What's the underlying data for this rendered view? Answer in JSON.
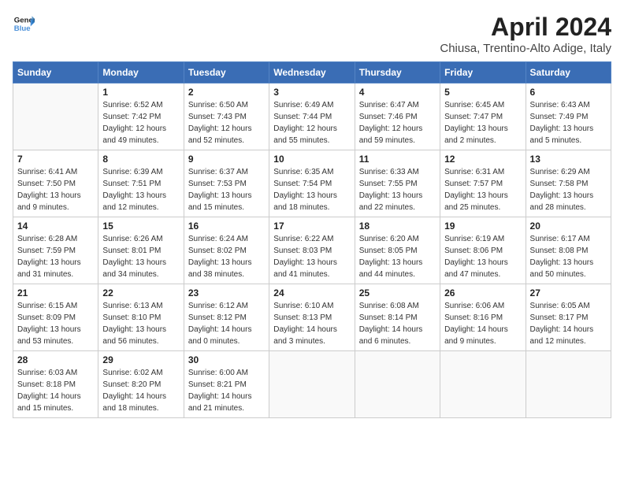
{
  "header": {
    "logo_line1": "General",
    "logo_line2": "Blue",
    "month_title": "April 2024",
    "subtitle": "Chiusa, Trentino-Alto Adige, Italy"
  },
  "weekdays": [
    "Sunday",
    "Monday",
    "Tuesday",
    "Wednesday",
    "Thursday",
    "Friday",
    "Saturday"
  ],
  "weeks": [
    [
      {
        "day": "",
        "info": ""
      },
      {
        "day": "1",
        "info": "Sunrise: 6:52 AM\nSunset: 7:42 PM\nDaylight: 12 hours\nand 49 minutes."
      },
      {
        "day": "2",
        "info": "Sunrise: 6:50 AM\nSunset: 7:43 PM\nDaylight: 12 hours\nand 52 minutes."
      },
      {
        "day": "3",
        "info": "Sunrise: 6:49 AM\nSunset: 7:44 PM\nDaylight: 12 hours\nand 55 minutes."
      },
      {
        "day": "4",
        "info": "Sunrise: 6:47 AM\nSunset: 7:46 PM\nDaylight: 12 hours\nand 59 minutes."
      },
      {
        "day": "5",
        "info": "Sunrise: 6:45 AM\nSunset: 7:47 PM\nDaylight: 13 hours\nand 2 minutes."
      },
      {
        "day": "6",
        "info": "Sunrise: 6:43 AM\nSunset: 7:49 PM\nDaylight: 13 hours\nand 5 minutes."
      }
    ],
    [
      {
        "day": "7",
        "info": "Sunrise: 6:41 AM\nSunset: 7:50 PM\nDaylight: 13 hours\nand 9 minutes."
      },
      {
        "day": "8",
        "info": "Sunrise: 6:39 AM\nSunset: 7:51 PM\nDaylight: 13 hours\nand 12 minutes."
      },
      {
        "day": "9",
        "info": "Sunrise: 6:37 AM\nSunset: 7:53 PM\nDaylight: 13 hours\nand 15 minutes."
      },
      {
        "day": "10",
        "info": "Sunrise: 6:35 AM\nSunset: 7:54 PM\nDaylight: 13 hours\nand 18 minutes."
      },
      {
        "day": "11",
        "info": "Sunrise: 6:33 AM\nSunset: 7:55 PM\nDaylight: 13 hours\nand 22 minutes."
      },
      {
        "day": "12",
        "info": "Sunrise: 6:31 AM\nSunset: 7:57 PM\nDaylight: 13 hours\nand 25 minutes."
      },
      {
        "day": "13",
        "info": "Sunrise: 6:29 AM\nSunset: 7:58 PM\nDaylight: 13 hours\nand 28 minutes."
      }
    ],
    [
      {
        "day": "14",
        "info": "Sunrise: 6:28 AM\nSunset: 7:59 PM\nDaylight: 13 hours\nand 31 minutes."
      },
      {
        "day": "15",
        "info": "Sunrise: 6:26 AM\nSunset: 8:01 PM\nDaylight: 13 hours\nand 34 minutes."
      },
      {
        "day": "16",
        "info": "Sunrise: 6:24 AM\nSunset: 8:02 PM\nDaylight: 13 hours\nand 38 minutes."
      },
      {
        "day": "17",
        "info": "Sunrise: 6:22 AM\nSunset: 8:03 PM\nDaylight: 13 hours\nand 41 minutes."
      },
      {
        "day": "18",
        "info": "Sunrise: 6:20 AM\nSunset: 8:05 PM\nDaylight: 13 hours\nand 44 minutes."
      },
      {
        "day": "19",
        "info": "Sunrise: 6:19 AM\nSunset: 8:06 PM\nDaylight: 13 hours\nand 47 minutes."
      },
      {
        "day": "20",
        "info": "Sunrise: 6:17 AM\nSunset: 8:08 PM\nDaylight: 13 hours\nand 50 minutes."
      }
    ],
    [
      {
        "day": "21",
        "info": "Sunrise: 6:15 AM\nSunset: 8:09 PM\nDaylight: 13 hours\nand 53 minutes."
      },
      {
        "day": "22",
        "info": "Sunrise: 6:13 AM\nSunset: 8:10 PM\nDaylight: 13 hours\nand 56 minutes."
      },
      {
        "day": "23",
        "info": "Sunrise: 6:12 AM\nSunset: 8:12 PM\nDaylight: 14 hours\nand 0 minutes."
      },
      {
        "day": "24",
        "info": "Sunrise: 6:10 AM\nSunset: 8:13 PM\nDaylight: 14 hours\nand 3 minutes."
      },
      {
        "day": "25",
        "info": "Sunrise: 6:08 AM\nSunset: 8:14 PM\nDaylight: 14 hours\nand 6 minutes."
      },
      {
        "day": "26",
        "info": "Sunrise: 6:06 AM\nSunset: 8:16 PM\nDaylight: 14 hours\nand 9 minutes."
      },
      {
        "day": "27",
        "info": "Sunrise: 6:05 AM\nSunset: 8:17 PM\nDaylight: 14 hours\nand 12 minutes."
      }
    ],
    [
      {
        "day": "28",
        "info": "Sunrise: 6:03 AM\nSunset: 8:18 PM\nDaylight: 14 hours\nand 15 minutes."
      },
      {
        "day": "29",
        "info": "Sunrise: 6:02 AM\nSunset: 8:20 PM\nDaylight: 14 hours\nand 18 minutes."
      },
      {
        "day": "30",
        "info": "Sunrise: 6:00 AM\nSunset: 8:21 PM\nDaylight: 14 hours\nand 21 minutes."
      },
      {
        "day": "",
        "info": ""
      },
      {
        "day": "",
        "info": ""
      },
      {
        "day": "",
        "info": ""
      },
      {
        "day": "",
        "info": ""
      }
    ]
  ]
}
